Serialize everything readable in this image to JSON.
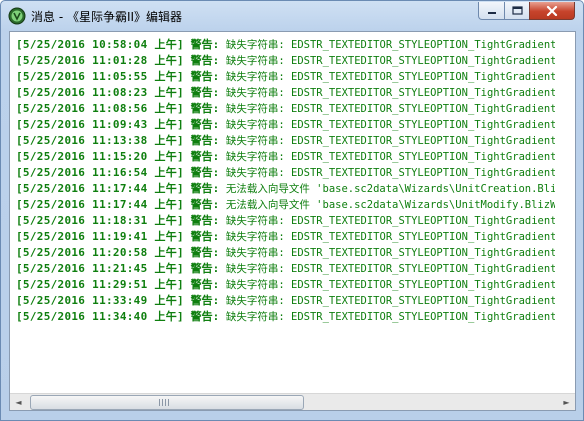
{
  "window": {
    "title": "消息 - 《星际争霸II》编辑器",
    "icon": "starcraft-editor-icon"
  },
  "controls": {
    "minimize": "minimize-icon",
    "maximize": "maximize-icon",
    "close": "close-icon"
  },
  "colors": {
    "log_text": "#0f7f0f"
  },
  "log": [
    {
      "time": "[5/25/2016 10:58:04 上午]",
      "level": "警告:",
      "text": "缺失字符串: EDSTR_TEXTEDITOR_STYLEOPTION_TightGradient"
    },
    {
      "time": "[5/25/2016 11:01:28 上午]",
      "level": "警告:",
      "text": "缺失字符串: EDSTR_TEXTEDITOR_STYLEOPTION_TightGradient"
    },
    {
      "time": "[5/25/2016 11:05:55 上午]",
      "level": "警告:",
      "text": "缺失字符串: EDSTR_TEXTEDITOR_STYLEOPTION_TightGradient"
    },
    {
      "time": "[5/25/2016 11:08:23 上午]",
      "level": "警告:",
      "text": "缺失字符串: EDSTR_TEXTEDITOR_STYLEOPTION_TightGradient"
    },
    {
      "time": "[5/25/2016 11:08:56 上午]",
      "level": "警告:",
      "text": "缺失字符串: EDSTR_TEXTEDITOR_STYLEOPTION_TightGradient"
    },
    {
      "time": "[5/25/2016 11:09:43 上午]",
      "level": "警告:",
      "text": "缺失字符串: EDSTR_TEXTEDITOR_STYLEOPTION_TightGradient"
    },
    {
      "time": "[5/25/2016 11:13:38 上午]",
      "level": "警告:",
      "text": "缺失字符串: EDSTR_TEXTEDITOR_STYLEOPTION_TightGradient"
    },
    {
      "time": "[5/25/2016 11:15:20 上午]",
      "level": "警告:",
      "text": "缺失字符串: EDSTR_TEXTEDITOR_STYLEOPTION_TightGradient"
    },
    {
      "time": "[5/25/2016 11:16:54 上午]",
      "level": "警告:",
      "text": "缺失字符串: EDSTR_TEXTEDITOR_STYLEOPTION_TightGradient"
    },
    {
      "time": "[5/25/2016 11:17:44 上午]",
      "level": "警告:",
      "text": "无法载入向导文件 'base.sc2data\\Wizards\\UnitCreation.Bliz"
    },
    {
      "time": "[5/25/2016 11:17:44 上午]",
      "level": "警告:",
      "text": "无法载入向导文件 'base.sc2data\\Wizards\\UnitModify.BlizWi"
    },
    {
      "time": "[5/25/2016 11:18:31 上午]",
      "level": "警告:",
      "text": "缺失字符串: EDSTR_TEXTEDITOR_STYLEOPTION_TightGradient"
    },
    {
      "time": "[5/25/2016 11:19:41 上午]",
      "level": "警告:",
      "text": "缺失字符串: EDSTR_TEXTEDITOR_STYLEOPTION_TightGradient"
    },
    {
      "time": "[5/25/2016 11:20:58 上午]",
      "level": "警告:",
      "text": "缺失字符串: EDSTR_TEXTEDITOR_STYLEOPTION_TightGradient"
    },
    {
      "time": "[5/25/2016 11:21:45 上午]",
      "level": "警告:",
      "text": "缺失字符串: EDSTR_TEXTEDITOR_STYLEOPTION_TightGradient"
    },
    {
      "time": "[5/25/2016 11:29:51 上午]",
      "level": "警告:",
      "text": "缺失字符串: EDSTR_TEXTEDITOR_STYLEOPTION_TightGradient"
    },
    {
      "time": "[5/25/2016 11:33:49 上午]",
      "level": "警告:",
      "text": "缺失字符串: EDSTR_TEXTEDITOR_STYLEOPTION_TightGradient"
    },
    {
      "time": "[5/25/2016 11:34:40 上午]",
      "level": "警告:",
      "text": "缺失字符串: EDSTR_TEXTEDITOR_STYLEOPTION_TightGradient"
    }
  ],
  "scrollbar": {
    "left_arrow": "◄",
    "right_arrow": "►",
    "position": 0.0,
    "visible_fraction": 0.5
  }
}
